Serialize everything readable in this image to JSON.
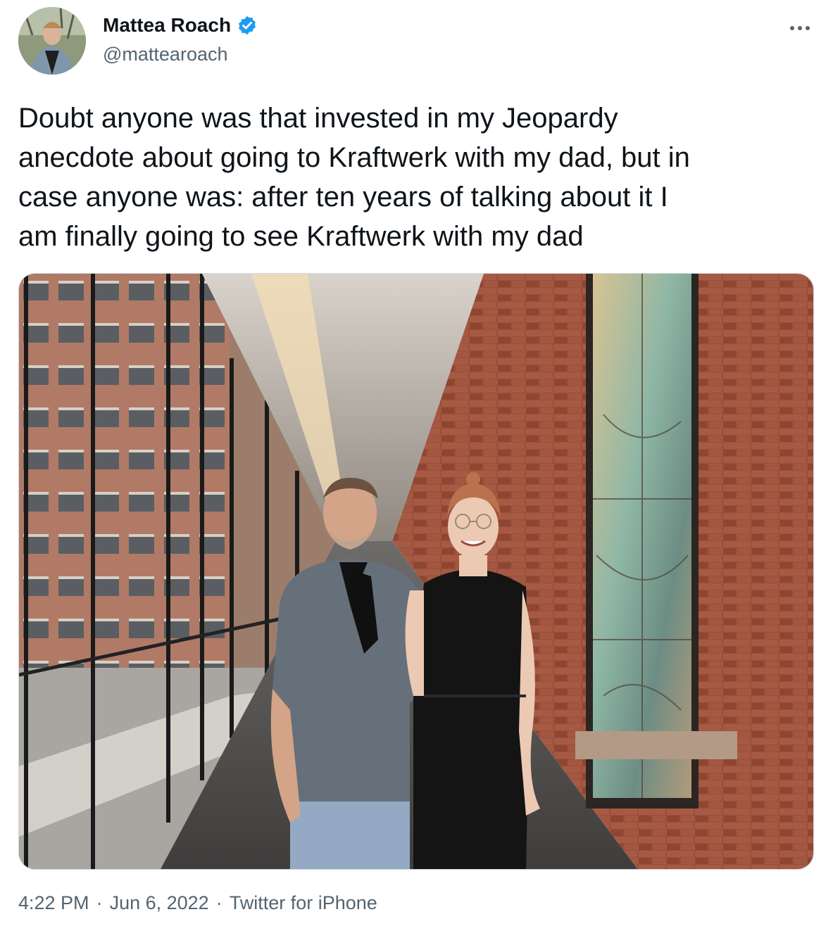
{
  "tweet": {
    "author": {
      "display_name": "Mattea Roach",
      "handle": "@mattearoach",
      "verified": true
    },
    "text": "Doubt anyone was that invested in my Jeopardy\nanecdote about going to Kraftwerk with my dad, but in\ncase anyone was: after ten years of talking about it I\nam finally going to see Kraftwerk with my dad",
    "footer": {
      "time": "4:22 PM",
      "separator": "·",
      "date": "Jun 6, 2022",
      "source": "Twitter for iPhone"
    }
  },
  "icons": {
    "verified": "verified-badge-icon",
    "more": "more-horizontal-icon"
  },
  "colors": {
    "text_primary": "#0f1419",
    "text_secondary": "#536471",
    "verified_blue": "#1d9bf0",
    "border": "#cfd9de"
  }
}
